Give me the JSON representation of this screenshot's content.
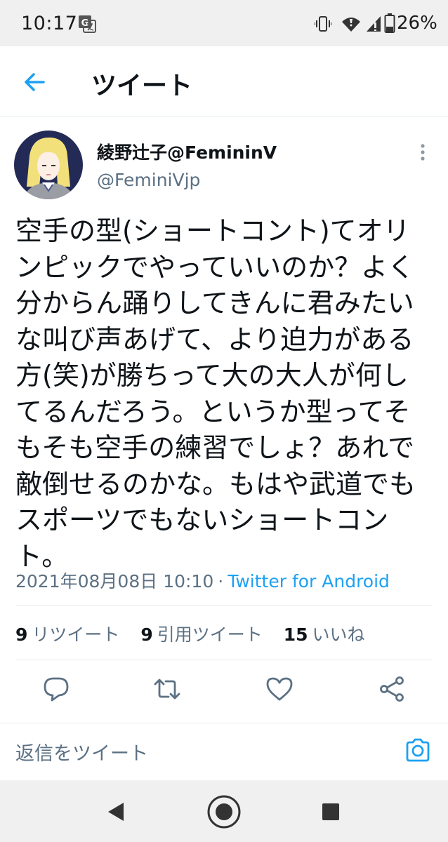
{
  "status_bar": {
    "time": "10:17",
    "battery": "26%",
    "icons": [
      "translate-icon",
      "vibrate-icon",
      "wifi-icon",
      "signal-icon",
      "battery-icon"
    ]
  },
  "header": {
    "title": "ツイート",
    "back_icon": "arrow-left-icon"
  },
  "tweet": {
    "display_name": "綾野辻子@FemininV",
    "handle": "@FeminiVjp",
    "text": "空手の型(ショートコント)てオリ\nンピックでやっていいのか？よく\n分からん踊りしてきんに君みたい\nな叫び声あげて、より迫力がある\n方(笑)が勝ちって大の大人が何し\nてるんだろう。というか型ってそ\nもそも空手の練習でしょ？あれで\n敵倒せるのかな。もはや武道でも\nスポーツでもないショートコン\nト。",
    "timestamp": "2021年08月08日 10:10",
    "separator": "·",
    "source": "Twitter for Android"
  },
  "stats": {
    "retweets_count": "9",
    "retweets_label": "リツイート",
    "quotes_count": "9",
    "quotes_label": "引用ツイート",
    "likes_count": "15",
    "likes_label": "いいね"
  },
  "actions": [
    "reply-icon",
    "retweet-icon",
    "like-icon",
    "share-icon"
  ],
  "reply": {
    "placeholder": "返信をツイート"
  },
  "colors": {
    "accent": "#1da1f2",
    "secondary_text": "#5b7083",
    "primary_text": "#0f1419",
    "system_bar": "#f0f0f0"
  }
}
